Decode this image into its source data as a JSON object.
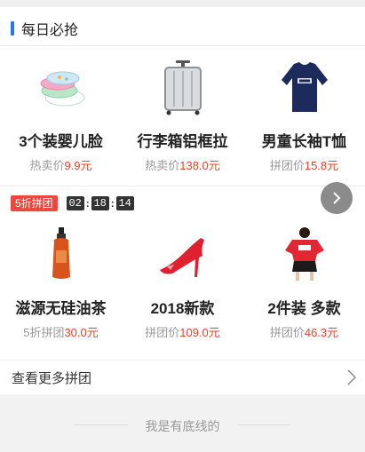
{
  "section": {
    "title": "每日必抢"
  },
  "daily": [
    {
      "name": "3个装婴儿脸",
      "price_label": "热卖价",
      "price": "9.9元",
      "icon": "basin-set-image"
    },
    {
      "name": "行李箱铝框拉",
      "price_label": "热卖价",
      "price": "138.0元",
      "icon": "suitcase-image"
    },
    {
      "name": "男童长袖T恤",
      "price_label": "拼团价",
      "price": "15.8元",
      "icon": "tshirt-image"
    }
  ],
  "group": {
    "badge": "5折拼团",
    "timer": {
      "hours": "02",
      "minutes": "18",
      "seconds": "14"
    },
    "next_icon": "chevron-right-icon",
    "items": [
      {
        "name": "滋源无硅油茶",
        "price_label": "5折拼团",
        "price": "30.0元",
        "icon": "shampoo-bottle-image"
      },
      {
        "name": "2018新款",
        "price_label": "拼团价",
        "price": "109.0元",
        "icon": "red-heels-image"
      },
      {
        "name": "2件装 多款",
        "price_label": "拼团价",
        "price": "46.3元",
        "icon": "red-outfit-image"
      }
    ]
  },
  "more": {
    "label": "查看更多拼团",
    "icon": "chevron-right-icon"
  },
  "footer": {
    "text": "我是有底线的"
  },
  "colors": {
    "accent": "#1f78ff",
    "price": "#e8452c",
    "badge": "#f0473c"
  }
}
